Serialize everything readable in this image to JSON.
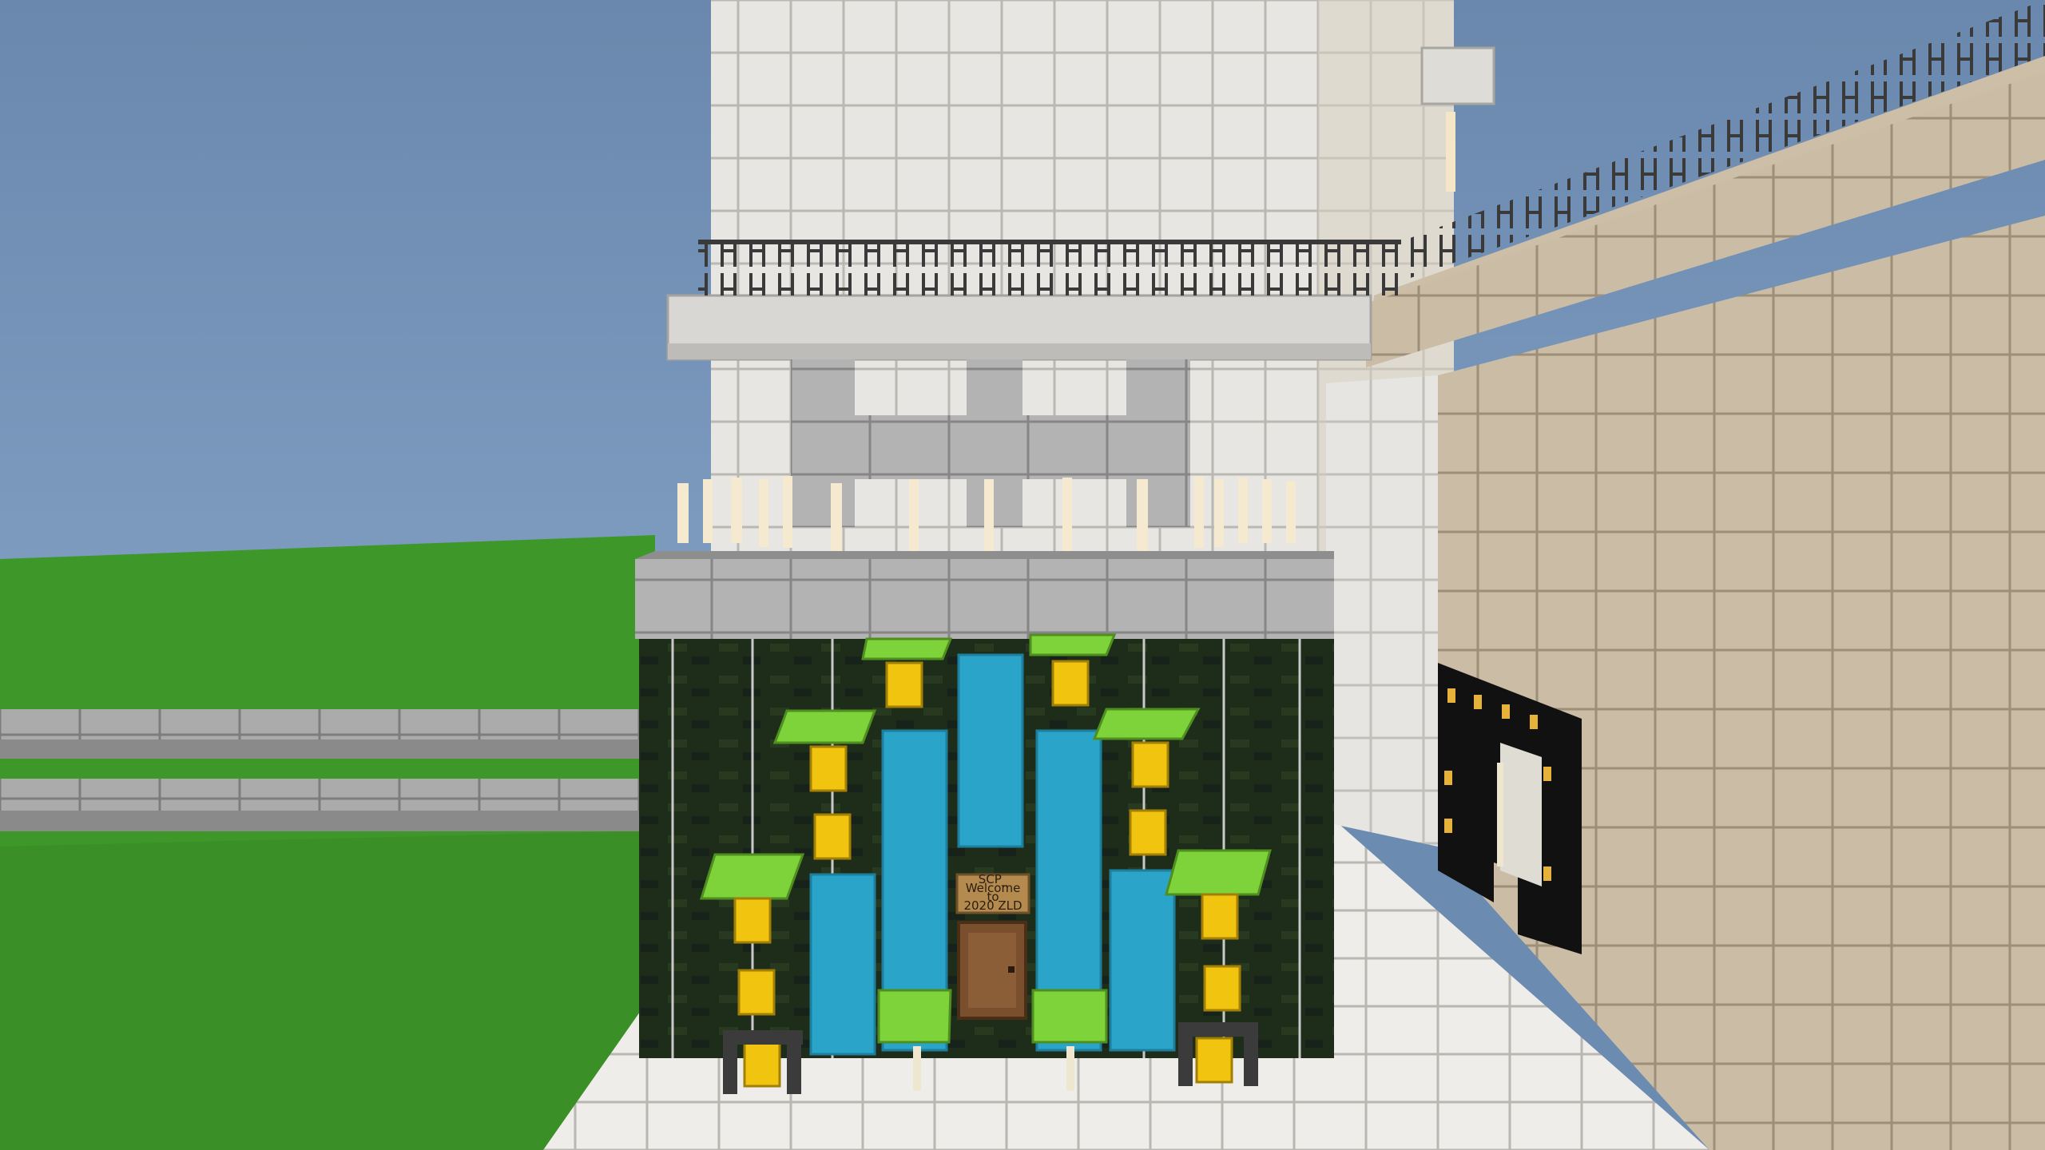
{
  "scene": {
    "kind": "game-3d-viewport",
    "game": "voxel block builder",
    "hud": "none",
    "palette": {
      "sky": "#6c8bb0",
      "grass": "#3f9a2a",
      "stone": "#a9a9a9",
      "quartz": "#e9e8e4",
      "sandstone": "#c8b9a1",
      "dark_wall": "#1c2a18",
      "water": "#2aa3c9",
      "leaf_slab": "#7fd43a",
      "bell": "#f1c40f",
      "door": "#7a4f2e"
    }
  },
  "sign": {
    "line1": "SCP_",
    "line2": "Welcome",
    "line3": "to",
    "line4": "2020 ZLD"
  }
}
